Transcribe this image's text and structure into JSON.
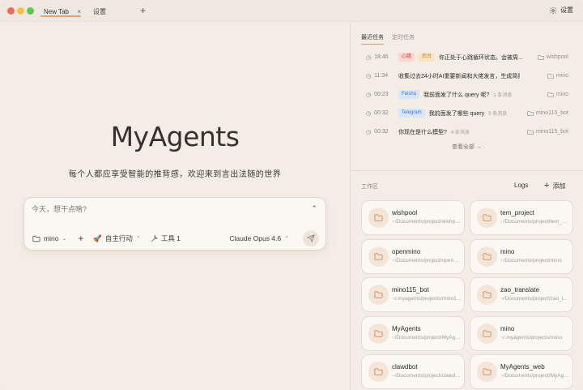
{
  "tabs": {
    "active_label": "New Tab",
    "close_glyph": "×",
    "settings_label": "设置",
    "new_tab_glyph": "+"
  },
  "titlebar": {
    "settings_label": "设置"
  },
  "hero": {
    "title": "MyAgents",
    "subtitle": "每个人都应享受智能的推背感，欢迎来到言出法随的世界"
  },
  "composer": {
    "placeholder": "今天，想干点啥?",
    "collapse_glyph": "⌃",
    "folder_label": "mino",
    "add_glyph": "+",
    "mode_label": "自主行动",
    "tools_label": "工具 1",
    "model_label": "Claude Opus 4.6"
  },
  "right": {
    "tab_recent": "最近任务",
    "tab_scheduled": "定时任务",
    "view_all": "查看全部 →",
    "workspace_label": "工作区",
    "logs_label": "Logs",
    "add_label": "添加"
  },
  "tasks": [
    {
      "time": "18:46",
      "badges": [
        {
          "text": "心跳",
          "kind": "red"
        },
        {
          "text": "后台",
          "kind": "orange"
        }
      ],
      "title": "你正处于心跳循环状态。会被周...",
      "count": "",
      "folder": "wishpool"
    },
    {
      "time": "11:34",
      "badges": [],
      "title": "收集过去24小时AI重要新闻和大佬发言，生成简报...",
      "count": "",
      "folder": "mino"
    },
    {
      "time": "00:23",
      "badges": [
        {
          "text": "Feishu",
          "kind": "blue"
        }
      ],
      "title": "我前面发了什么 query 呢?",
      "count": "1 条消息",
      "folder": "mino"
    },
    {
      "time": "00:32",
      "badges": [
        {
          "text": "Telegram",
          "kind": "blue"
        }
      ],
      "title": "我前面发了哪些 query",
      "count": "3 条消息",
      "folder": "mino115_bot"
    },
    {
      "time": "00:32",
      "badges": [],
      "title": "你现在是什么模型?",
      "count": "4 条消息",
      "folder": "mino115_bot"
    }
  ],
  "workspaces": [
    {
      "name": "wishpool",
      "path": "~/Documents/project/wishpool"
    },
    {
      "name": "tem_project",
      "path": "~/Documents/project/tem_project"
    },
    {
      "name": "openmino",
      "path": "~/Documents/project/openmino"
    },
    {
      "name": "mino",
      "path": "~/Documents/project/mino"
    },
    {
      "name": "mino115_bot",
      "path": "~/.myagents/projects/mino115_bot"
    },
    {
      "name": "zao_translate",
      "path": "~/Documents/project/zao_translate"
    },
    {
      "name": "MyAgents",
      "path": "~/Documents/project/MyAgents"
    },
    {
      "name": "mino",
      "path": "~/.myagents/projects/mino"
    },
    {
      "name": "clawdbot",
      "path": "~/Documents/project/clawdbot"
    },
    {
      "name": "MyAgents_web",
      "path": "~/Documents/project/MyAgents_web"
    }
  ],
  "colors": {
    "background": "#f3ede6",
    "accent": "#c9a07a",
    "folder_icon": "#d08a5a",
    "badge_red_bg": "#fbd5d0",
    "badge_red_fg": "#c8453a",
    "badge_orange_bg": "#fbe3c4",
    "badge_orange_fg": "#c07a2a",
    "badge_blue_bg": "#d8e6fb",
    "badge_blue_fg": "#3a6fc4"
  }
}
